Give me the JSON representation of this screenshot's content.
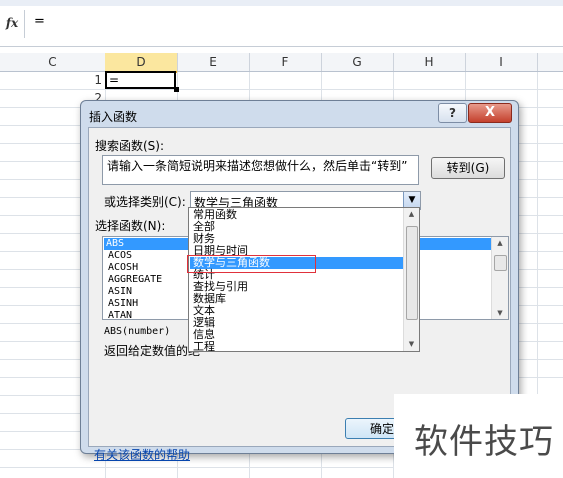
{
  "formula_bar": {
    "fx_label": "fx",
    "content": "="
  },
  "columns": {
    "c": "C",
    "d": "D",
    "e": "E",
    "f": "F",
    "g": "G",
    "h": "H",
    "i": "I"
  },
  "rows": {
    "r1": "1",
    "r2": "2"
  },
  "active_cell": {
    "value": "="
  },
  "dialog": {
    "title": "插入函数",
    "help_label": "?",
    "close_label": "X",
    "search_label": "搜索函数(S):",
    "search_value": "请输入一条简短说明来描述您想做什么，然后单击“转到”",
    "goto_label": "转到(G)",
    "category_label": "或选择类别(C):",
    "category_value": "数学与三角函数",
    "function_label": "选择函数(N):",
    "functions": [
      "ABS",
      "ACOS",
      "ACOSH",
      "AGGREGATE",
      "ASIN",
      "ASINH",
      "ATAN"
    ],
    "syntax": "ABS(number)",
    "description": "返回给定数值的绝",
    "help_link": "有关该函数的帮助",
    "ok_label": "确定"
  },
  "category_dropdown": {
    "items": [
      "常用函数",
      "全部",
      "财务",
      "日期与时间",
      "数学与三角函数",
      "统计",
      "查找与引用",
      "数据库",
      "文本",
      "逻辑",
      "信息",
      "工程"
    ],
    "selected_index": 4
  },
  "watermark": {
    "text": "软件技巧"
  },
  "colors": {
    "selection": "#3399ff",
    "highlight_box": "#e0313b",
    "dialog_frame": "#cfdcec"
  }
}
